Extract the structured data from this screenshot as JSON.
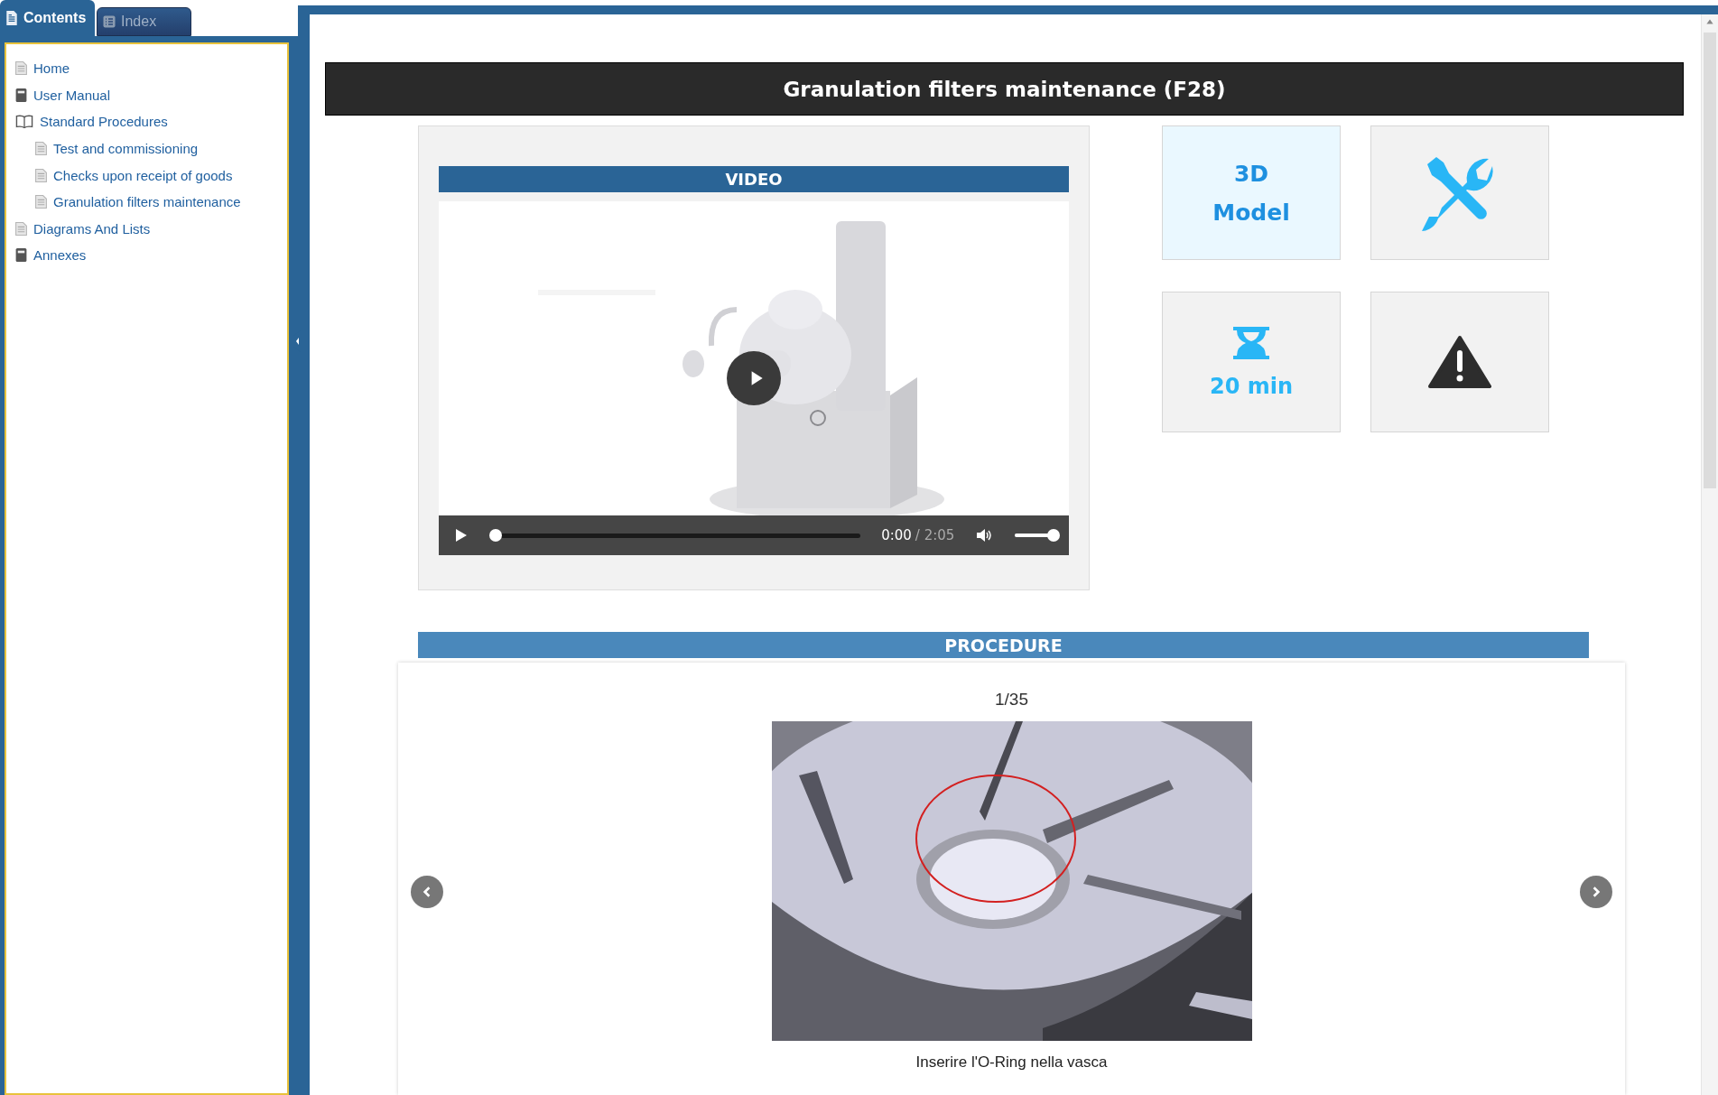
{
  "sidebar": {
    "tabs": [
      {
        "label": "Contents",
        "selected": true
      },
      {
        "label": "Index",
        "selected": false
      }
    ],
    "items": [
      {
        "label": "Home",
        "kind": "page"
      },
      {
        "label": "User Manual",
        "kind": "book",
        "expanded": false
      },
      {
        "label": "Standard Procedures",
        "kind": "book",
        "expanded": true,
        "children": [
          {
            "label": "Test and commissioning",
            "kind": "page"
          },
          {
            "label": "Checks upon receipt of goods",
            "kind": "page"
          },
          {
            "label": "Granulation filters maintenance",
            "kind": "page"
          }
        ]
      },
      {
        "label": "Diagrams And Lists",
        "kind": "page"
      },
      {
        "label": "Annexes",
        "kind": "book",
        "expanded": false
      }
    ]
  },
  "page": {
    "title": "Granulation filters maintenance (F28)",
    "video": {
      "heading": "VIDEO",
      "current_time": "0:00",
      "duration": "/ 2:05",
      "progress": {
        "level": 0
      },
      "volume": {
        "level": 1
      }
    },
    "tiles": [
      {
        "kind": "text",
        "lines": [
          "3D",
          "Model"
        ],
        "highlighted": true
      },
      {
        "kind": "tools",
        "highlighted": false
      },
      {
        "kind": "timer",
        "label": "20 min",
        "highlighted": false
      },
      {
        "kind": "warning",
        "highlighted": false
      }
    ],
    "procedure": {
      "heading": "PROCEDURE",
      "counter": "1/35",
      "caption": "Inserire l'O-Ring nella vasca"
    }
  }
}
